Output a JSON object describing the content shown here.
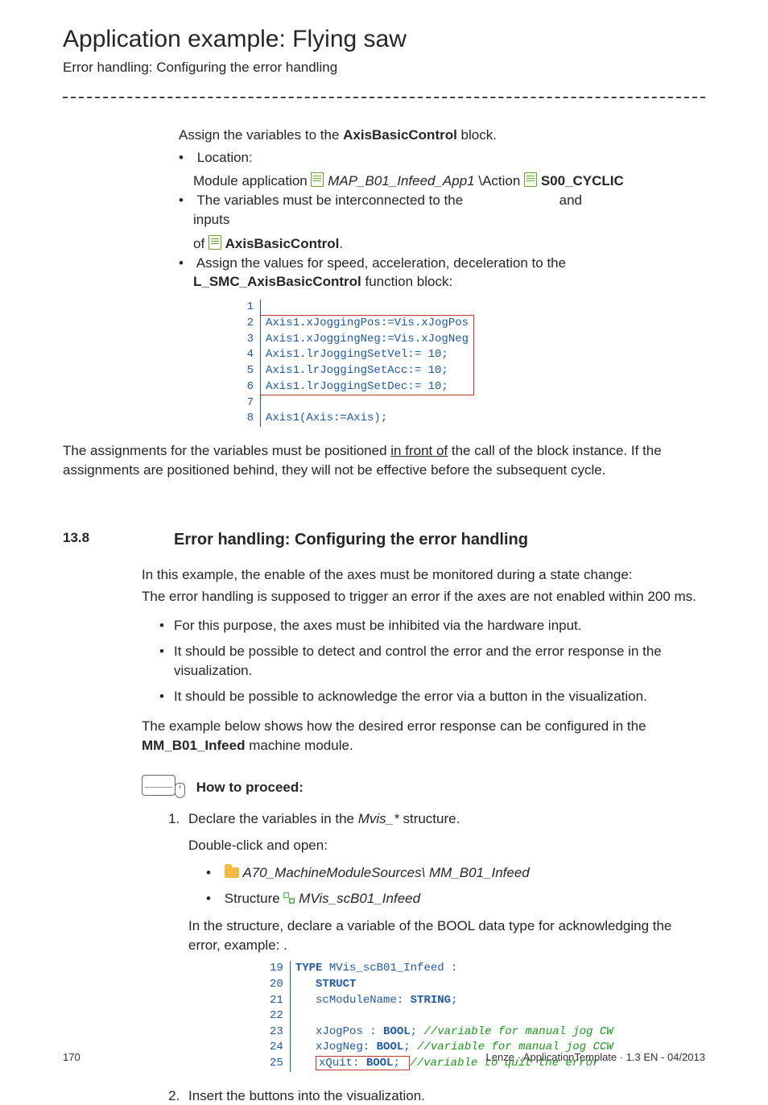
{
  "header": {
    "title": "Application example: Flying saw",
    "subtitle": "Error handling: Configuring the error handling"
  },
  "s1": {
    "assign_intro_pre": "Assign the variables to the ",
    "assign_intro_bold": "AxisBasicControl",
    "assign_intro_post": " block.",
    "loc_label": "Location:",
    "loc_module_app": "Module application ",
    "loc_app_name": "MAP_B01_Infeed_App1",
    "loc_action": "Action ",
    "loc_cyclic": "S00_CYCLIC",
    "intercon_pre": "The variables must be interconnected to the ",
    "intercon_and": " and ",
    "intercon_post": " inputs",
    "intercon_of": "of ",
    "intercon_block": "AxisBasicControl",
    "intercon_dot": ".",
    "assign_values_pre": "Assign the values for speed, acceleration, deceleration to the ",
    "assign_values_bold": "L_SMC_AxisBasicControl",
    "assign_values_post": " function block:"
  },
  "code1": {
    "l1": "",
    "l2": "Axis1.xJoggingPos:=Vis.xJogPos",
    "l3": "Axis1.xJoggingNeg:=Vis.xJogNeg",
    "l4": "Axis1.lrJoggingSetVel:= 10;",
    "l5": "Axis1.lrJoggingSetAcc:= 10;",
    "l6": "Axis1.lrJoggingSetDec:= 10;",
    "l7": "",
    "l8": "Axis1(Axis:=Axis);"
  },
  "s2": {
    "note_pre": "The assignments for the variables must be positioned ",
    "note_u": "in front of",
    "note_post": " the call of the block instance. If the assignments are positioned behind, they will not be effective before the subsequent cycle."
  },
  "sec": {
    "num": "13.8",
    "title": "Error handling: Configuring the error handling"
  },
  "s3": {
    "p1": "In this example, the enable of the axes must be monitored during a state change:",
    "p2": "The error handling is supposed to trigger an error if the axes are not enabled within 200 ms.",
    "b1": "For this purpose, the axes must be inhibited via the hardware input.",
    "b2": "It should be possible to detect and control the error and the error response in the visualization.",
    "b3": "It should be possible to acknowledge the error via a button in the visualization.",
    "p3_pre": "The example below shows how the desired error response can be configured in the ",
    "p3_bold": "MM_B01_Infeed",
    "p3_post": " machine module."
  },
  "proceed": "How to proceed:",
  "step1": {
    "t1_pre": "Declare the variables in the ",
    "t1_it": "Mvis_*",
    "t1_post": " structure.",
    "t2": "Double-click and open:",
    "path1": "A70_MachineModuleSources\\ MM_B01_Infeed",
    "t3_pre": "Structure  ",
    "t3_it": "MVis_scB01_Infeed",
    "t4": "In the structure, declare a variable of the BOOL data type for acknowledging the error, example:        ."
  },
  "code2": {
    "n19": "19",
    "n20": "20",
    "n21": "21",
    "n22": "22",
    "n23": "23",
    "n24": "24",
    "n25": "25",
    "l19_a": "TYPE ",
    "l19_b": "MVis_scB01_Infeed :",
    "l20": "STRUCT",
    "l21_a": "scModuleName: ",
    "l21_b": "STRING",
    "l21_c": ";",
    "l22": "",
    "l23_a": "xJogPos : ",
    "l23_b": "BOOL",
    "l23_c": "; ",
    "l23_d": "//variable for manual jog CW",
    "l24_a": "xJogNeg: ",
    "l24_b": "BOOL",
    "l24_c": "; ",
    "l24_d": "//variable for manual jog CCW",
    "l25_a": "xQuit: ",
    "l25_b": "BOOL",
    "l25_c": "; ",
    "l25_d": "//variable to quit the error"
  },
  "step2": "Insert the buttons into the visualization.",
  "footer": {
    "page": "170",
    "right": "Lenze · ApplicationTemplate · 1.3 EN - 04/2013"
  }
}
